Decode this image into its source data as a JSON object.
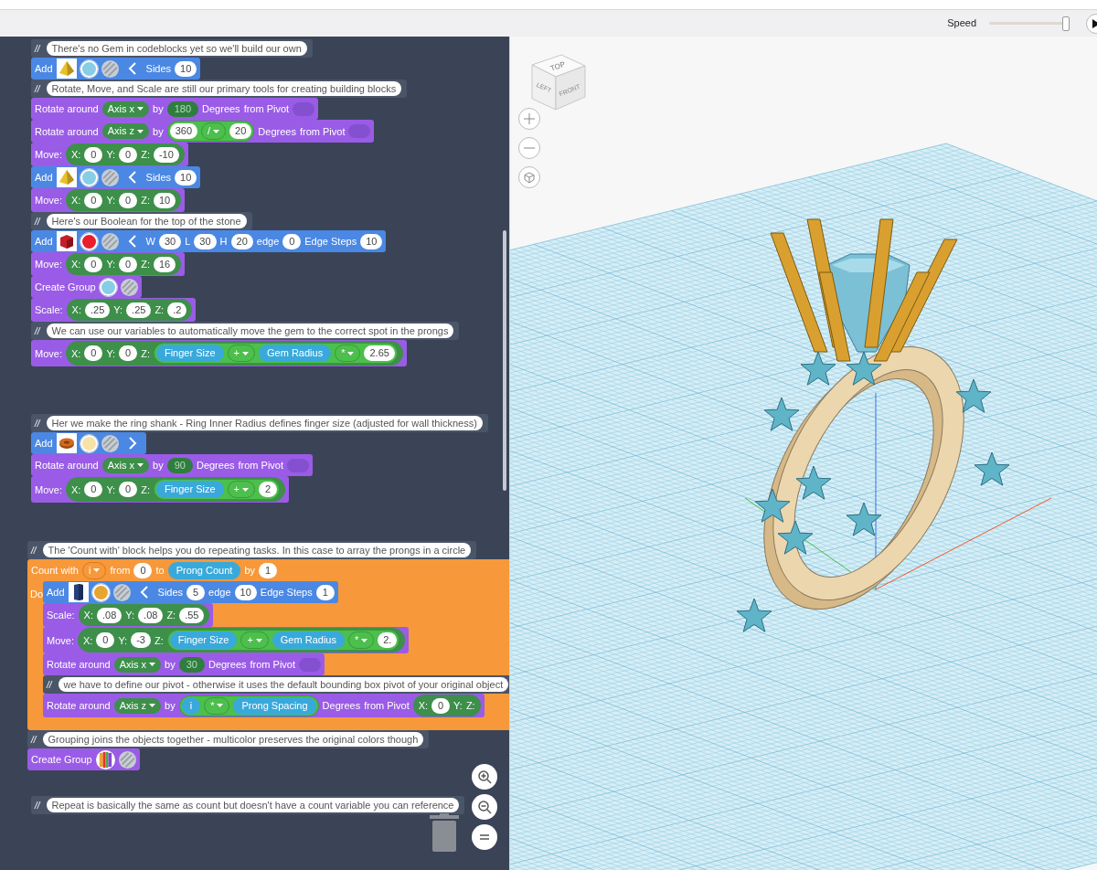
{
  "toolbar": {
    "speed_label": "Speed",
    "speed": {
      "level": 0.96
    }
  },
  "code_panel": {
    "stacks": [
      {
        "blocks": [
          {
            "kind": "comment",
            "marker": "//",
            "text": "There's no Gem in codeblocks yet so we'll build our own"
          },
          {
            "kind": "add",
            "parts": [
              {
                "kind": "label",
                "text": "Add"
              },
              {
                "kind": "pyramid",
                "color": "#e8c12a"
              },
              {
                "kind": "swatch",
                "color": "#87cde6"
              },
              {
                "kind": "hatch"
              },
              {
                "kind": "chevron",
                "expanded": false
              },
              {
                "kind": "label",
                "text": "Sides"
              },
              {
                "kind": "num",
                "text": "10"
              }
            ]
          },
          {
            "kind": "comment",
            "marker": "//",
            "text": "Rotate, Move, and Scale are still our primary tools for creating building blocks"
          },
          {
            "kind": "action",
            "parts": [
              {
                "kind": "label",
                "text": "Rotate around"
              },
              {
                "kind": "dropdown",
                "text": "Axis x"
              },
              {
                "kind": "label",
                "text": "by"
              },
              {
                "kind": "shadow",
                "text": "180"
              },
              {
                "kind": "label",
                "text": "Degrees"
              },
              {
                "kind": "label",
                "text": "from Pivot"
              },
              {
                "kind": "toggle",
                "on": false
              }
            ]
          },
          {
            "kind": "action",
            "parts": [
              {
                "kind": "label",
                "text": "Rotate around"
              },
              {
                "kind": "dropdown",
                "text": "Axis z"
              },
              {
                "kind": "label",
                "text": "by"
              },
              {
                "kind": "expr",
                "children": [
                  {
                    "kind": "num",
                    "text": "360"
                  },
                  {
                    "kind": "dropdown",
                    "text": "/"
                  },
                  {
                    "kind": "num",
                    "text": "20"
                  }
                ]
              },
              {
                "kind": "label",
                "text": "Degrees"
              },
              {
                "kind": "label",
                "text": "from Pivot"
              },
              {
                "kind": "toggle",
                "on": false
              }
            ]
          },
          {
            "kind": "action",
            "parts": [
              {
                "kind": "label",
                "text": "Move:"
              },
              {
                "kind": "xyz",
                "children": [
                  {
                    "kind": "label",
                    "text": "X:"
                  },
                  {
                    "kind": "num",
                    "text": "0"
                  },
                  {
                    "kind": "label",
                    "text": "Y:"
                  },
                  {
                    "kind": "num",
                    "text": "0"
                  },
                  {
                    "kind": "label",
                    "text": "Z:"
                  },
                  {
                    "kind": "num",
                    "text": "-10"
                  }
                ]
              }
            ]
          },
          {
            "kind": "add",
            "parts": [
              {
                "kind": "label",
                "text": "Add"
              },
              {
                "kind": "pyramid",
                "color": "#e8c12a"
              },
              {
                "kind": "swatch",
                "color": "#87cde6"
              },
              {
                "kind": "hatch"
              },
              {
                "kind": "chevron",
                "expanded": false
              },
              {
                "kind": "label",
                "text": "Sides"
              },
              {
                "kind": "num",
                "text": "10"
              }
            ]
          },
          {
            "kind": "action",
            "parts": [
              {
                "kind": "label",
                "text": "Move:"
              },
              {
                "kind": "xyz",
                "children": [
                  {
                    "kind": "label",
                    "text": "X:"
                  },
                  {
                    "kind": "num",
                    "text": "0"
                  },
                  {
                    "kind": "label",
                    "text": "Y:"
                  },
                  {
                    "kind": "num",
                    "text": "0"
                  },
                  {
                    "kind": "label",
                    "text": "Z:"
                  },
                  {
                    "kind": "num",
                    "text": "10"
                  }
                ]
              }
            ]
          },
          {
            "kind": "comment",
            "marker": "//",
            "text": "Here's our Boolean for the top of the stone"
          },
          {
            "kind": "add",
            "parts": [
              {
                "kind": "label",
                "text": "Add"
              },
              {
                "kind": "cube",
                "color": "#c41e2a"
              },
              {
                "kind": "swatch",
                "color": "#e81e2a"
              },
              {
                "kind": "hatch"
              },
              {
                "kind": "chevron",
                "expanded": false
              },
              {
                "kind": "label",
                "text": "W"
              },
              {
                "kind": "num",
                "text": "30"
              },
              {
                "kind": "label",
                "text": "L"
              },
              {
                "kind": "num",
                "text": "30"
              },
              {
                "kind": "label",
                "text": "H"
              },
              {
                "kind": "num",
                "text": "20"
              },
              {
                "kind": "label",
                "text": "edge"
              },
              {
                "kind": "num",
                "text": "0"
              },
              {
                "kind": "label",
                "text": "Edge Steps"
              },
              {
                "kind": "num",
                "text": "10"
              }
            ]
          },
          {
            "kind": "action",
            "parts": [
              {
                "kind": "label",
                "text": "Move:"
              },
              {
                "kind": "xyz",
                "children": [
                  {
                    "kind": "label",
                    "text": "X:"
                  },
                  {
                    "kind": "num",
                    "text": "0"
                  },
                  {
                    "kind": "label",
                    "text": "Y:"
                  },
                  {
                    "kind": "num",
                    "text": "0"
                  },
                  {
                    "kind": "label",
                    "text": "Z:"
                  },
                  {
                    "kind": "num",
                    "text": "16"
                  }
                ]
              }
            ]
          },
          {
            "kind": "action",
            "parts": [
              {
                "kind": "label",
                "text": "Create Group"
              },
              {
                "kind": "swatch",
                "color": "#87cde6"
              },
              {
                "kind": "hatch"
              }
            ]
          },
          {
            "kind": "action",
            "parts": [
              {
                "kind": "label",
                "text": "Scale:"
              },
              {
                "kind": "xyz",
                "children": [
                  {
                    "kind": "label",
                    "text": "X:"
                  },
                  {
                    "kind": "num",
                    "text": ".25"
                  },
                  {
                    "kind": "label",
                    "text": "Y:"
                  },
                  {
                    "kind": "num",
                    "text": ".25"
                  },
                  {
                    "kind": "label",
                    "text": "Z:"
                  },
                  {
                    "kind": "num",
                    "text": ".2"
                  }
                ]
              }
            ]
          },
          {
            "kind": "comment",
            "marker": "//",
            "text": "We can use our variables to automatically move the gem to the correct spot in the prongs"
          },
          {
            "kind": "action",
            "parts": [
              {
                "kind": "label",
                "text": "Move:"
              },
              {
                "kind": "xyz",
                "children": [
                  {
                    "kind": "label",
                    "text": "X:"
                  },
                  {
                    "kind": "num",
                    "text": "0"
                  },
                  {
                    "kind": "label",
                    "text": "Y:"
                  },
                  {
                    "kind": "num",
                    "text": "0"
                  },
                  {
                    "kind": "label",
                    "text": "Z:"
                  },
                  {
                    "kind": "expr",
                    "children": [
                      {
                        "kind": "var",
                        "text": "Finger Size"
                      },
                      {
                        "kind": "dropdown",
                        "text": "+"
                      },
                      {
                        "kind": "var",
                        "text": "Gem Radius"
                      },
                      {
                        "kind": "dropdown",
                        "text": "*"
                      },
                      {
                        "kind": "num",
                        "text": "2.65"
                      }
                    ]
                  }
                ]
              }
            ]
          }
        ]
      },
      {
        "blocks": [
          {
            "kind": "comment",
            "marker": "//",
            "text": "Her we make the ring shank - Ring Inner Radius defines finger size (adjusted for wall thickness)"
          },
          {
            "kind": "add",
            "parts": [
              {
                "kind": "label",
                "text": "Add"
              },
              {
                "kind": "torus",
                "color": "#d2691e"
              },
              {
                "kind": "swatch",
                "color": "#f8e2a8"
              },
              {
                "kind": "hatch"
              },
              {
                "kind": "chevron",
                "expanded": true
              }
            ]
          },
          {
            "kind": "action",
            "parts": [
              {
                "kind": "label",
                "text": "Rotate around"
              },
              {
                "kind": "dropdown",
                "text": "Axis x"
              },
              {
                "kind": "label",
                "text": "by"
              },
              {
                "kind": "shadow",
                "text": "90"
              },
              {
                "kind": "label",
                "text": "Degrees"
              },
              {
                "kind": "label",
                "text": "from Pivot"
              },
              {
                "kind": "toggle",
                "on": false
              }
            ]
          },
          {
            "kind": "action",
            "parts": [
              {
                "kind": "label",
                "text": "Move:"
              },
              {
                "kind": "xyz",
                "children": [
                  {
                    "kind": "label",
                    "text": "X:"
                  },
                  {
                    "kind": "num",
                    "text": "0"
                  },
                  {
                    "kind": "label",
                    "text": "Y:"
                  },
                  {
                    "kind": "num",
                    "text": "0"
                  },
                  {
                    "kind": "label",
                    "text": "Z:"
                  },
                  {
                    "kind": "expr",
                    "children": [
                      {
                        "kind": "var",
                        "text": "Finger Size"
                      },
                      {
                        "kind": "dropdown",
                        "text": "+"
                      },
                      {
                        "kind": "num",
                        "text": "2"
                      }
                    ]
                  }
                ]
              }
            ]
          }
        ]
      },
      {
        "blocks": [
          {
            "kind": "comment",
            "marker": "//",
            "text": "The 'Count with' block helps you do repeating tasks. In this case to array the prongs in a circle"
          },
          {
            "kind": "loop",
            "parts": [
              {
                "kind": "label",
                "text": "Count with"
              },
              {
                "kind": "dropdown",
                "text": "i"
              },
              {
                "kind": "label",
                "text": "from"
              },
              {
                "kind": "num",
                "text": "0"
              },
              {
                "kind": "label",
                "text": "to"
              },
              {
                "kind": "var",
                "text": "Prong Count"
              },
              {
                "kind": "label",
                "text": "by"
              },
              {
                "kind": "num",
                "text": "1"
              }
            ],
            "do_label": "Do",
            "children": [
              {
                "kind": "add",
                "parts": [
                  {
                    "kind": "label",
                    "text": "Add"
                  },
                  {
                    "kind": "prism",
                    "color": "#26407a"
                  },
                  {
                    "kind": "swatch",
                    "color": "#e8a430"
                  },
                  {
                    "kind": "hatch"
                  },
                  {
                    "kind": "chevron",
                    "expanded": false
                  },
                  {
                    "kind": "label",
                    "text": "Sides"
                  },
                  {
                    "kind": "num",
                    "text": "5"
                  },
                  {
                    "kind": "label",
                    "text": "edge"
                  },
                  {
                    "kind": "num",
                    "text": "10"
                  },
                  {
                    "kind": "label",
                    "text": "Edge Steps"
                  },
                  {
                    "kind": "num",
                    "text": "1"
                  }
                ]
              },
              {
                "kind": "action",
                "parts": [
                  {
                    "kind": "label",
                    "text": "Scale:"
                  },
                  {
                    "kind": "xyz",
                    "children": [
                      {
                        "kind": "label",
                        "text": "X:"
                      },
                      {
                        "kind": "num",
                        "text": ".08"
                      },
                      {
                        "kind": "label",
                        "text": "Y:"
                      },
                      {
                        "kind": "num",
                        "text": ".08"
                      },
                      {
                        "kind": "label",
                        "text": "Z:"
                      },
                      {
                        "kind": "num",
                        "text": ".55"
                      }
                    ]
                  }
                ]
              },
              {
                "kind": "action",
                "parts": [
                  {
                    "kind": "label",
                    "text": "Move:"
                  },
                  {
                    "kind": "xyz",
                    "children": [
                      {
                        "kind": "label",
                        "text": "X:"
                      },
                      {
                        "kind": "num",
                        "text": "0"
                      },
                      {
                        "kind": "label",
                        "text": "Y:"
                      },
                      {
                        "kind": "num",
                        "text": "-3"
                      },
                      {
                        "kind": "label",
                        "text": "Z:"
                      },
                      {
                        "kind": "expr",
                        "children": [
                          {
                            "kind": "var",
                            "text": "Finger Size"
                          },
                          {
                            "kind": "dropdown",
                            "text": "+"
                          },
                          {
                            "kind": "var",
                            "text": "Gem Radius"
                          },
                          {
                            "kind": "dropdown",
                            "text": "*"
                          },
                          {
                            "kind": "num",
                            "text": "2."
                          }
                        ]
                      }
                    ]
                  }
                ]
              },
              {
                "kind": "action",
                "parts": [
                  {
                    "kind": "label",
                    "text": "Rotate around"
                  },
                  {
                    "kind": "dropdown",
                    "text": "Axis x"
                  },
                  {
                    "kind": "label",
                    "text": "by"
                  },
                  {
                    "kind": "shadow",
                    "text": "30"
                  },
                  {
                    "kind": "label",
                    "text": "Degrees"
                  },
                  {
                    "kind": "label",
                    "text": "from Pivot"
                  },
                  {
                    "kind": "toggle",
                    "on": false
                  }
                ]
              },
              {
                "kind": "comment",
                "marker": "//",
                "text": "we have to define our pivot - otherwise it uses the default bounding box pivot of your original object"
              },
              {
                "kind": "action",
                "parts": [
                  {
                    "kind": "label",
                    "text": "Rotate around"
                  },
                  {
                    "kind": "dropdown",
                    "text": "Axis z"
                  },
                  {
                    "kind": "label",
                    "text": "by"
                  },
                  {
                    "kind": "expr",
                    "children": [
                      {
                        "kind": "var",
                        "text": "i"
                      },
                      {
                        "kind": "dropdown",
                        "text": "*"
                      },
                      {
                        "kind": "var",
                        "text": "Prong Spacing"
                      }
                    ]
                  },
                  {
                    "kind": "label",
                    "text": "Degrees"
                  },
                  {
                    "kind": "label",
                    "text": "from Pivot"
                  },
                  {
                    "kind": "xyz",
                    "children": [
                      {
                        "kind": "label",
                        "text": "X:"
                      },
                      {
                        "kind": "num",
                        "text": "0"
                      },
                      {
                        "kind": "label",
                        "text": "Y:"
                      },
                      {
                        "kind": "label",
                        "text": "Z:"
                      }
                    ]
                  }
                ]
              }
            ]
          },
          {
            "kind": "comment",
            "marker": "//",
            "text": "Grouping joins the objects together - multicolor preserves the original colors though"
          },
          {
            "kind": "action",
            "parts": [
              {
                "kind": "label",
                "text": "Create Group"
              },
              {
                "kind": "multicolor"
              },
              {
                "kind": "hatch"
              }
            ]
          }
        ]
      },
      {
        "blocks": [
          {
            "kind": "comment",
            "marker": "//",
            "text": "Repeat is basically the same as count but doesn't have a count variable you can reference"
          }
        ]
      }
    ]
  },
  "viewport": {
    "view_cube": {
      "faces": [
        "TOP",
        "LEFT",
        "FRONT"
      ]
    }
  }
}
